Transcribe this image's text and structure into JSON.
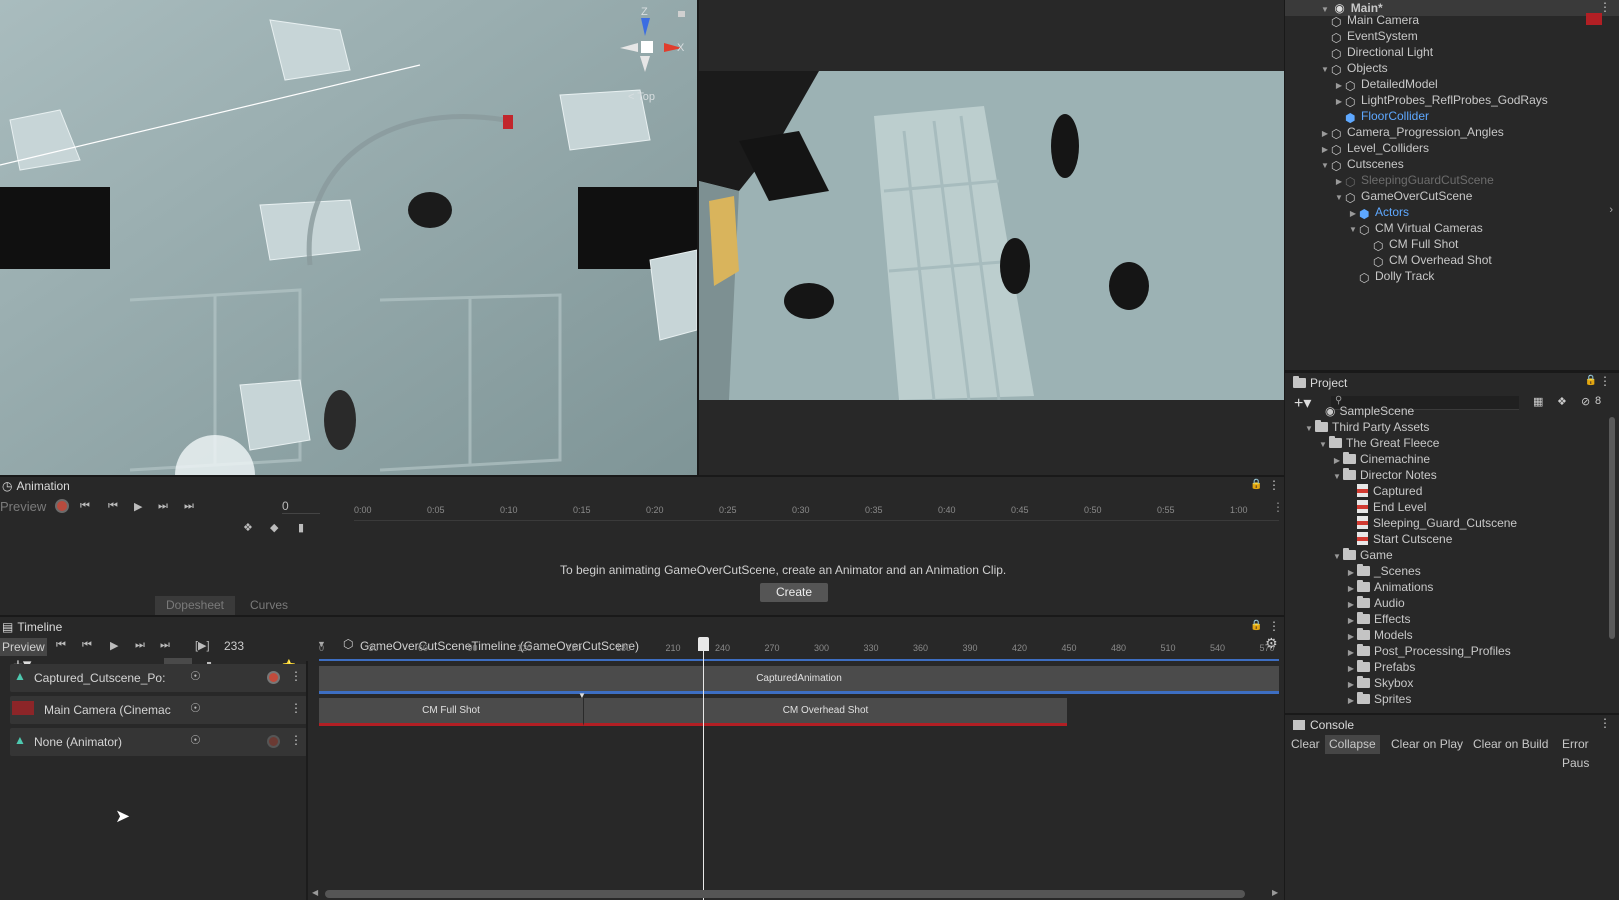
{
  "scene_view": {
    "gizmo_labels": {
      "z": "Z",
      "x": "X",
      "view": "< Top"
    }
  },
  "hierarchy": {
    "scene_name": "Main*",
    "items": [
      "Main Camera",
      "EventSystem",
      "Directional Light",
      "Objects",
      "DetailedModel",
      "LightProbes_ReflProbes_GodRays",
      "FloorCollider",
      "Camera_Progression_Angles",
      "Level_Colliders",
      "Cutscenes",
      "SleepingGuardCutScene",
      "GameOverCutScene",
      "Actors",
      "CM Virtual Cameras",
      "CM Full Shot",
      "CM Overhead Shot",
      "Dolly Track"
    ]
  },
  "project": {
    "tab": "Project",
    "hidden_count": "8",
    "items": [
      "SampleScene",
      "Third Party Assets",
      "The Great Fleece",
      "Cinemachine",
      "Director Notes",
      "Captured",
      "End Level",
      "Sleeping_Guard_Cutscene",
      "Start Cutscene",
      "Game",
      "_Scenes",
      "Animations",
      "Audio",
      "Effects",
      "Models",
      "Post_Processing_Profiles",
      "Prefabs",
      "Skybox",
      "Sprites"
    ]
  },
  "console": {
    "tab": "Console",
    "buttons": [
      "Clear",
      "Collapse",
      "Clear on Play",
      "Clear on Build",
      "Error Paus"
    ]
  },
  "animation": {
    "tab": "Animation",
    "preview_label": "Preview",
    "frame_value": "0",
    "ruler": [
      "0:00",
      "0:05",
      "0:10",
      "0:15",
      "0:20",
      "0:25",
      "0:30",
      "0:35",
      "0:40",
      "0:45",
      "0:50",
      "0:55",
      "1:00"
    ],
    "message": "To begin animating GameOverCutScene, create an Animator and an Animation Clip.",
    "create_label": "Create",
    "dopesheet_label": "Dopesheet",
    "curves_label": "Curves"
  },
  "timeline": {
    "tab": "Timeline",
    "preview_label": "Preview",
    "frame_value": "233",
    "asset_title": "GameOverCutSceneTimeline (GameOverCutScene)",
    "ruler": [
      "0",
      "30",
      "60",
      "90",
      "120",
      "150",
      "180",
      "210",
      "240",
      "270",
      "300",
      "330",
      "360",
      "390",
      "420",
      "450",
      "480",
      "510",
      "540",
      "570"
    ],
    "playhead_frame": 233,
    "tracks": [
      {
        "name": "Captured_Cutscene_Po:"
      },
      {
        "name": "Main Camera (Cinemac"
      },
      {
        "name": "None (Animator)"
      }
    ],
    "clips": {
      "captured": "CapturedAnimation",
      "full_shot": "CM Full Shot",
      "overhead_shot": "CM Overhead Shot"
    }
  },
  "colors": {
    "accent_blue": "#3d6ec2",
    "camera_red": "#b21f24",
    "animation_teal": "#4ec9b0"
  }
}
